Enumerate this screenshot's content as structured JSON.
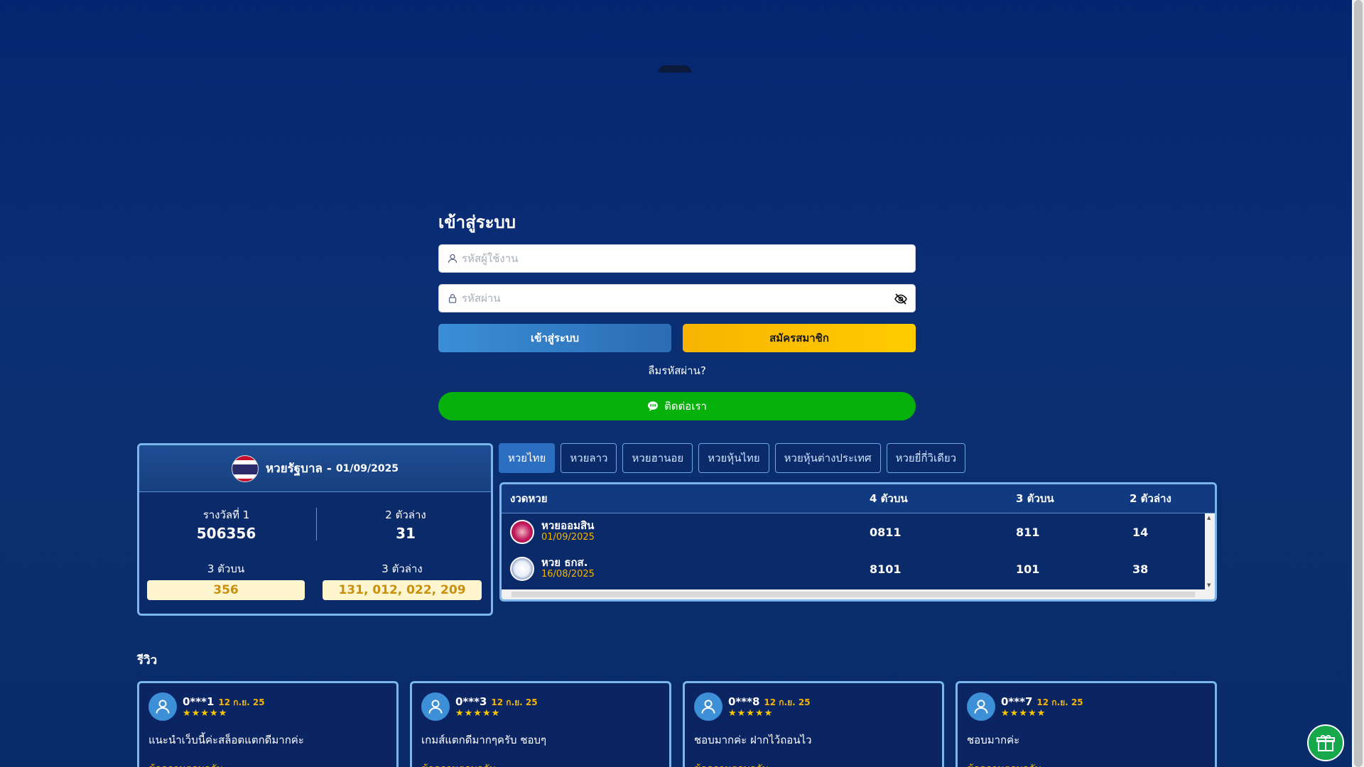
{
  "login": {
    "title": "เข้าสู่ระบบ",
    "username_placeholder": "รหัสผู้ใช้งาน",
    "password_placeholder": "รหัสผ่าน",
    "login_button": "เข้าสู่ระบบ",
    "register_button": "สมัครสมาชิก",
    "forgot_link": "ลืมรหัสผ่าน?",
    "contact_button": "ติดต่อเรา"
  },
  "result_card": {
    "title": "หวยรัฐบาล -",
    "date": "01/09/2025",
    "first_prize_label": "รางวัลที่ 1",
    "first_prize_value": "506356",
    "two_lower_label": "2 ตัวล่าง",
    "two_lower_value": "31",
    "three_upper_label": "3 ตัวบน",
    "three_upper_value": "356",
    "three_lower_label": "3 ตัวล่าง",
    "three_lower_value": "131, 012, 022, 209"
  },
  "tabs": [
    "หวยไทย",
    "หวยลาว",
    "หวยฮานอย",
    "หวยหุ้นไทย",
    "หวยหุ้นต่างประเทศ",
    "หวยยี่กี่วิเดียว"
  ],
  "table": {
    "headers": [
      "งวดหวย",
      "4 ตัวบน",
      "3 ตัวบน",
      "2 ตัวล่าง"
    ],
    "rows": [
      {
        "name": "หวยออมสิน",
        "date": "01/09/2025",
        "four_upper": "0811",
        "three_upper": "811",
        "two_lower": "14"
      },
      {
        "name": "หวย ธกส.",
        "date": "16/08/2025",
        "four_upper": "8101",
        "three_upper": "101",
        "two_lower": "38"
      }
    ]
  },
  "reviews": {
    "title": "รีวิว",
    "items": [
      {
        "user": "0***1",
        "date": "12 ก.ย. 25",
        "stars": "★★★★★",
        "text": "แนะนำเว็บนี้ค่ะสล็อตแตกดีมากค่ะ",
        "more": "ข้อความตอบกลับ"
      },
      {
        "user": "0***3",
        "date": "12 ก.ย. 25",
        "stars": "★★★★★",
        "text": "เกมส์แตกดีมากๆครับ ชอบๆ",
        "more": "ข้อความตอบกลับ"
      },
      {
        "user": "0***8",
        "date": "12 ก.ย. 25",
        "stars": "★★★★★",
        "text": "ชอบมากค่ะ ฝากไว้ถอนไว",
        "more": "ข้อความตอบกลับ"
      },
      {
        "user": "0***7",
        "date": "12 ก.ย. 25",
        "stars": "★★★★★",
        "text": "ชอบมากค่ะ",
        "more": "ข้อความตอบกลับ"
      }
    ]
  },
  "colors": {
    "background": "#0a2d75",
    "accent_blue": "#2c6fc0",
    "register_yellow": "#ffcc00",
    "contact_green": "#06b10b",
    "highlight_gold": "#f7b500"
  },
  "icons": [
    "user-icon",
    "lock-icon",
    "eye-off-icon",
    "line-chat-icon",
    "thai-flag-icon",
    "gsb-logo-icon",
    "baac-logo-icon",
    "avatar-icon",
    "star-icon",
    "gift-icon"
  ]
}
